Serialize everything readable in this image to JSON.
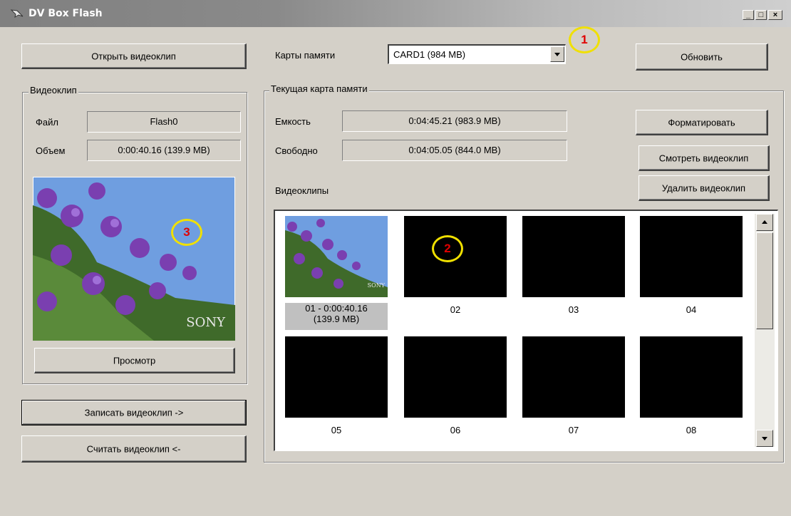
{
  "window": {
    "title": "DV Box Flash",
    "controls": [
      "_",
      "□",
      "×"
    ]
  },
  "buttons": {
    "open_clip": "Открыть видеоклип",
    "refresh": "Обновить",
    "format": "Форматировать",
    "view_clip": "Смотреть видеоклип",
    "delete_clip": "Удалить видеоклип",
    "preview": "Просмотр",
    "write_clip": "Записать видеоклип ->",
    "read_clip": "Считать видеоклип <-"
  },
  "memory_cards": {
    "label": "Карты памяти",
    "selected": "CARD1  (984 MB)"
  },
  "clip_group": {
    "title": "Видеоклип",
    "file_label": "Файл",
    "file_value": "Flash0",
    "size_label": "Объем",
    "size_value": "0:00:40.16  (139.9 MB)",
    "watermark": "SONY"
  },
  "card_group": {
    "title": "Текущая карта памяти",
    "capacity_label": "Емкость",
    "capacity_value": "0:04:45.21  (983.9 MB)",
    "free_label": "Свободно",
    "free_value": "0:04:05.05  (844.0 MB)"
  },
  "clips_label": "Видеоклипы",
  "clips": [
    {
      "line1": "01 - 0:00:40.16",
      "line2": "(139.9 MB)",
      "has_image": true
    },
    {
      "line1": "02"
    },
    {
      "line1": "03"
    },
    {
      "line1": "04"
    },
    {
      "line1": "05"
    },
    {
      "line1": "06"
    },
    {
      "line1": "07"
    },
    {
      "line1": "08"
    }
  ],
  "callouts": [
    "1",
    "2",
    "3"
  ],
  "colors": {
    "callout_ring": "#f0e000",
    "callout_text": "#e00000",
    "thumb_bg": "#000000"
  }
}
